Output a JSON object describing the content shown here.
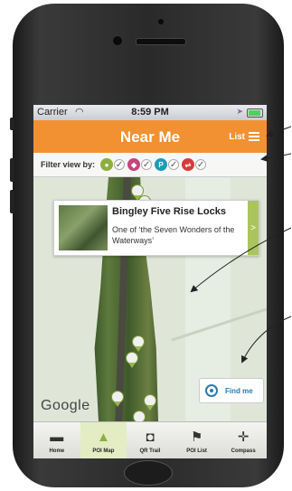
{
  "status": {
    "carrier": "Carrier",
    "time": "8:59 PM"
  },
  "navbar": {
    "title": "Near Me",
    "list_label": "List"
  },
  "filter": {
    "label": "Filter view by:",
    "chips": [
      {
        "icon": "trail-icon",
        "color": "#8eae3e"
      },
      {
        "icon": "food-icon",
        "color": "#c2477a"
      },
      {
        "icon": "parking-icon",
        "color": "#1f9bb8",
        "letter": "P"
      },
      {
        "icon": "rail-icon",
        "color": "#d83b3b",
        "letter": "⇌"
      }
    ]
  },
  "callout": {
    "title": "Bingley Five Rise Locks",
    "description": "One of ‘the Seven Wonders of the Waterways’"
  },
  "map": {
    "provider": "Google",
    "find_me_label": "Find me"
  },
  "tabs": [
    {
      "label": "Home",
      "icon": "boat-icon",
      "glyph": "▬",
      "active": false
    },
    {
      "label": "POI Map",
      "icon": "map-icon",
      "glyph": "▲",
      "active": true
    },
    {
      "label": "QR Trail",
      "icon": "camera-icon",
      "glyph": "◘",
      "active": false
    },
    {
      "label": "POI List",
      "icon": "flag-icon",
      "glyph": "⚑",
      "active": false
    },
    {
      "label": "Compass",
      "icon": "compass-icon",
      "glyph": "✛",
      "active": false
    }
  ]
}
